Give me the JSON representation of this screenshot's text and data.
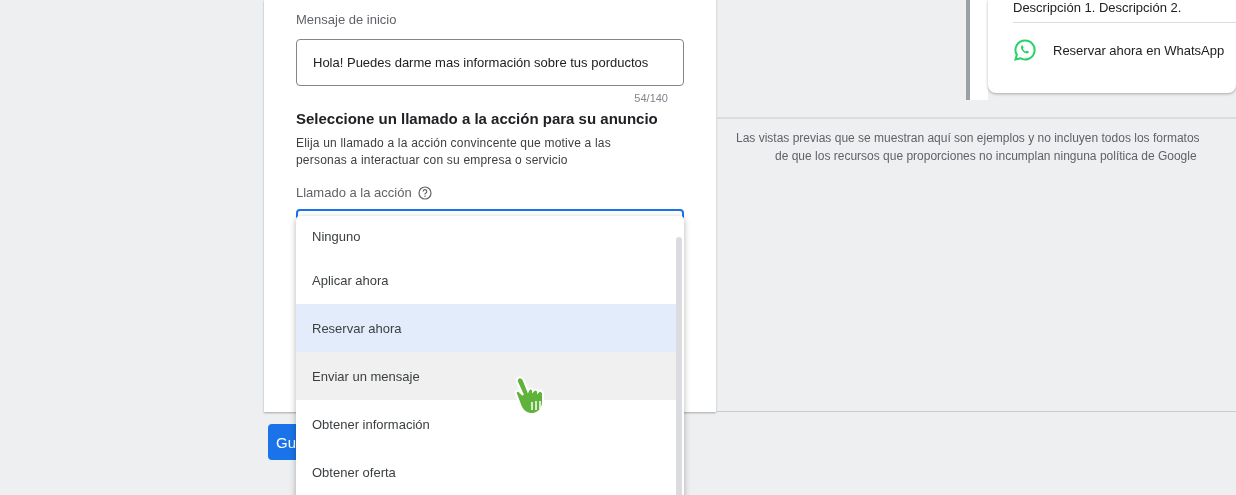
{
  "form": {
    "message_label": "Mensaje de inicio",
    "message_value": "Hola! Puedes darme mas información sobre tus porductos",
    "counter": "54/140",
    "cta_heading": "Seleccione un llamado a la acción para su anuncio",
    "cta_description": "Elija un llamado a la acción convincente que motive a las personas a interactuar con su empresa o servicio",
    "cta_label": "Llamado a la acción"
  },
  "dropdown": {
    "options": [
      {
        "label": "Ninguno",
        "selected": false,
        "hovered": false
      },
      {
        "label": "Aplicar ahora",
        "selected": false,
        "hovered": false
      },
      {
        "label": "Reservar ahora",
        "selected": true,
        "hovered": false
      },
      {
        "label": "Enviar un mensaje",
        "selected": false,
        "hovered": true
      },
      {
        "label": "Obtener información",
        "selected": false,
        "hovered": false
      },
      {
        "label": "Obtener oferta",
        "selected": false,
        "hovered": false
      }
    ]
  },
  "preview": {
    "description": "Descripción 1. Descripción 2.",
    "whatsapp_cta": "Reservar ahora en WhatsApp",
    "disclaimer_lines": [
      "Las vistas previas que se muestran aquí son ejemplos y no incluyen todos los formatos",
      "de que los recursos que proporciones no incumplan ninguna política de Google"
    ]
  },
  "save_button": {
    "label": "Gu"
  }
}
